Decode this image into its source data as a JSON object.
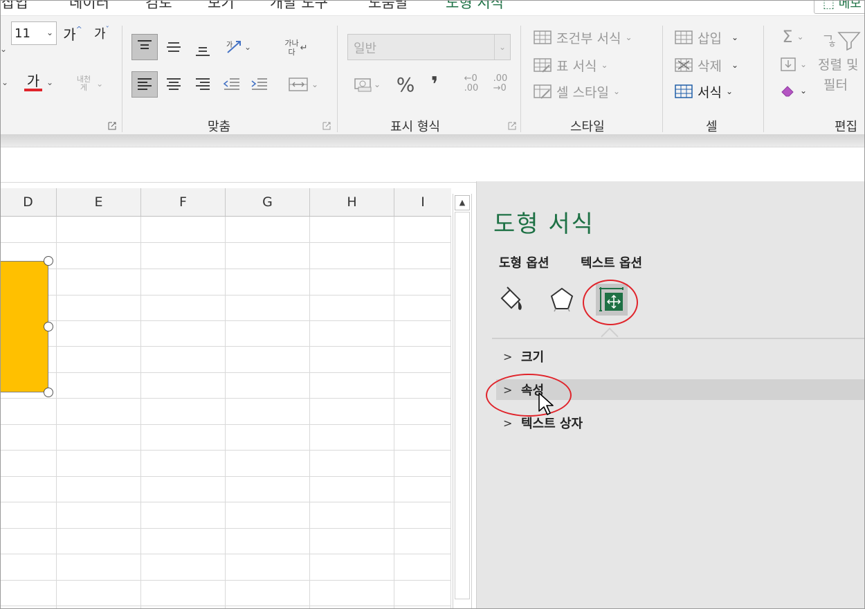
{
  "tabs": [
    "삽입",
    "데이터",
    "검토",
    "보기",
    "개발 도구",
    "도움말",
    "도형 서식"
  ],
  "active_tab": "도형 서식",
  "share_button": "메모",
  "ribbon": {
    "font": {
      "size": "11",
      "grow_label": "가",
      "shrink_label": "가",
      "font_color_label": "가",
      "phonetic_label_top": "내천",
      "phonetic_label_bottom": "게"
    },
    "alignment": {
      "label": "맞춤",
      "wrap_top": "가나",
      "wrap_bottom": "다"
    },
    "number": {
      "label": "표시 형식",
      "format_value": "일반",
      "percent": "%",
      "comma": "❜",
      "inc_decimal": ".00",
      "dec_decimal": ".00"
    },
    "styles": {
      "label": "스타일",
      "conditional": "조건부 서식",
      "table": "표 서식",
      "cell_styles": "셀 스타일"
    },
    "cells": {
      "label": "셀",
      "insert": "삽입",
      "delete": "삭제",
      "format": "서식"
    },
    "editing": {
      "label": "편집",
      "sum_icon": "Σ",
      "sort_top": "정렬 및",
      "sort_bottom": "필터"
    }
  },
  "sheet": {
    "columns": [
      "D",
      "E",
      "F",
      "G",
      "H",
      "I"
    ],
    "shape_fill": "#ffc000"
  },
  "pane": {
    "title": "도형 서식",
    "tabs": [
      "도형 옵션",
      "텍스트 옵션"
    ],
    "icons": [
      "fill-line-icon",
      "effects-pentagon-icon",
      "size-properties-icon"
    ],
    "sections": [
      "크기",
      "속성",
      "텍스트 상자"
    ],
    "accent": "#1e7145",
    "highlight": "#e0242b"
  }
}
